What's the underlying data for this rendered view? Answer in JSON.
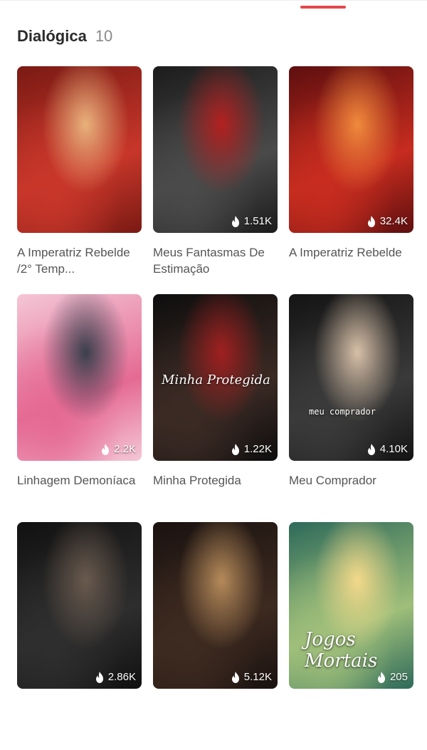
{
  "section": {
    "title": "Dialógica",
    "count": "10"
  },
  "books": [
    {
      "title": "A Imperatriz Rebelde /2° Temp...",
      "views": "",
      "cover_colors": [
        "#7a1a14",
        "#c8362a",
        "#e9b27c"
      ]
    },
    {
      "title": "Meus Fantasmas De Estimação",
      "views": "1.51K",
      "cover_colors": [
        "#1c1c1c",
        "#4a4a4a",
        "#b32020"
      ]
    },
    {
      "title": "A Imperatriz Rebelde",
      "views": "32.4K",
      "cover_colors": [
        "#5e0f0f",
        "#c72c1f",
        "#f08a3c"
      ]
    },
    {
      "title": "Linhagem Demoníaca",
      "views": "2.2K",
      "cover_colors": [
        "#f4c6d6",
        "#e56a93",
        "#3a3f4d"
      ]
    },
    {
      "title": "Minha Protegida",
      "views": "1.22K",
      "cover_colors": [
        "#0e0e0e",
        "#3b2a24",
        "#a02020"
      ],
      "cover_text": "Minha Protegida"
    },
    {
      "title": "Meu Comprador",
      "views": "4.10K",
      "cover_colors": [
        "#141414",
        "#3a3a3a",
        "#d8c0a8"
      ],
      "cover_text": "meu comprador"
    },
    {
      "title": "",
      "views": "2.86K",
      "cover_colors": [
        "#111111",
        "#2e2e2e",
        "#6a5a4e"
      ]
    },
    {
      "title": "",
      "views": "5.12K",
      "cover_colors": [
        "#1a1210",
        "#3d2a20",
        "#b58a5a"
      ]
    },
    {
      "title": "",
      "views": "205",
      "cover_colors": [
        "#2e6a5a",
        "#9fbf7a",
        "#f3d98a"
      ],
      "cover_text": "Jogos Mortais"
    }
  ],
  "icons": {
    "views": "flame-icon"
  },
  "colors": {
    "accent": "#e5474b"
  }
}
